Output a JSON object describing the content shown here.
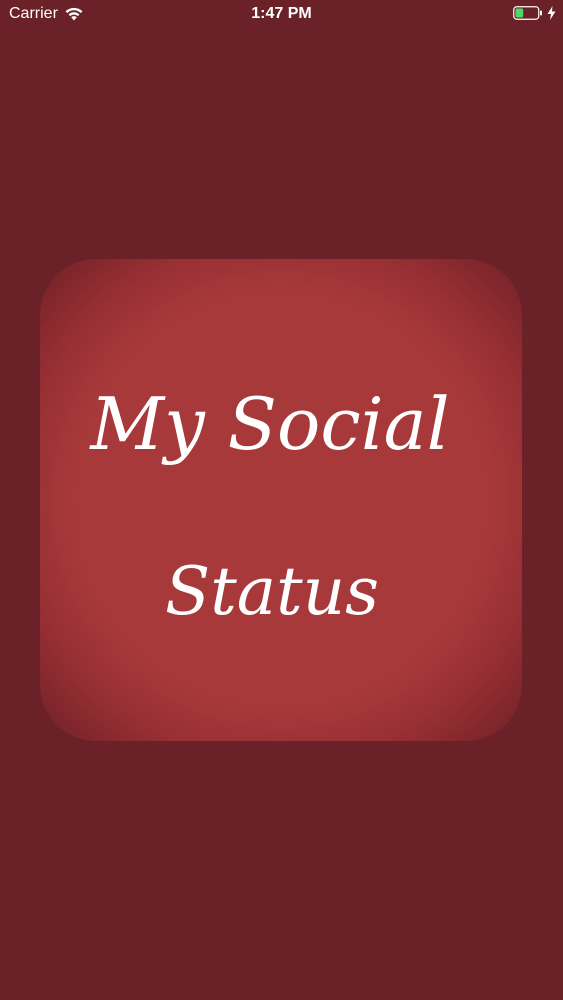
{
  "status_bar": {
    "carrier": "Carrier",
    "time": "1:47 PM",
    "icons": [
      "wifi-icon",
      "battery-icon",
      "charging-bolt-icon"
    ],
    "battery_level": 0.35,
    "battery_color": "#4cd964"
  },
  "splash": {
    "title_line1": "My Social",
    "title_line2": "Status",
    "background_color": "#6b2128",
    "logo_color": "#a8393a",
    "text_color": "#ffffff"
  }
}
